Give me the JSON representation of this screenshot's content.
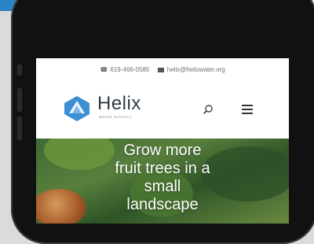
{
  "contact": {
    "phone": "619-466-0585",
    "email": "helix@helixwater.org"
  },
  "brand": {
    "name": "Helix",
    "subtitle": "WATER DISTRICT",
    "logo_icon": "helix-logo-icon"
  },
  "nav": {
    "search_icon": "search-icon",
    "menu_icon": "hamburger-menu-icon"
  },
  "hero": {
    "title_lines": [
      "Grow more",
      "fruit trees in a",
      "small",
      "landscape"
    ]
  },
  "colors": {
    "accent_blue": "#2a83c4",
    "logo_blue": "#3b8fd3",
    "text_dark": "#2f3a44"
  }
}
